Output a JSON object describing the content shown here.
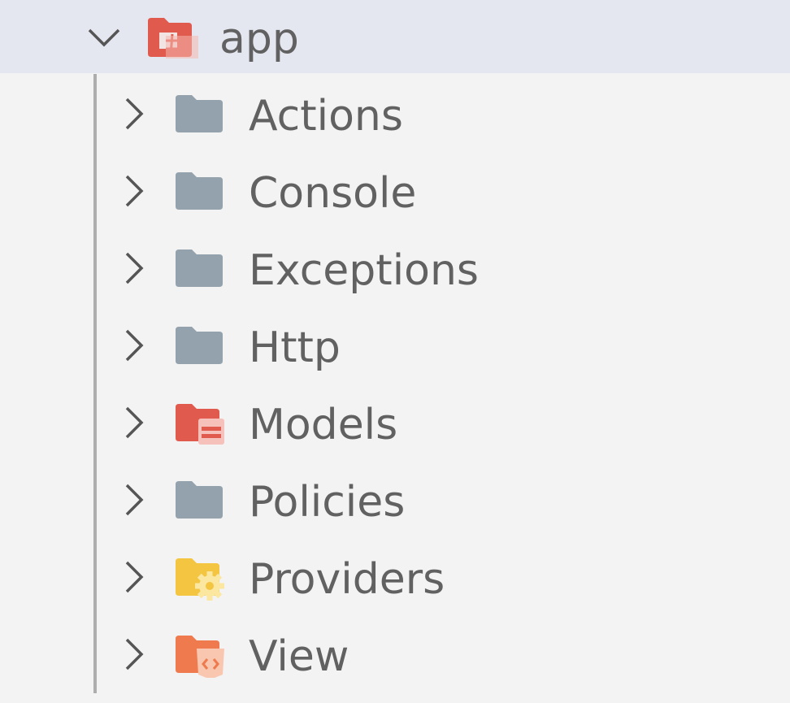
{
  "root": {
    "label": "app",
    "expanded": true,
    "icon": "folder-app-icon",
    "icon_color": "#e05a4e"
  },
  "children": [
    {
      "label": "Actions",
      "icon": "folder-icon",
      "color": "#93a2ad"
    },
    {
      "label": "Console",
      "icon": "folder-icon",
      "color": "#93a2ad"
    },
    {
      "label": "Exceptions",
      "icon": "folder-icon",
      "color": "#93a2ad"
    },
    {
      "label": "Http",
      "icon": "folder-icon",
      "color": "#93a2ad"
    },
    {
      "label": "Models",
      "icon": "folder-models-icon",
      "color": "#e05a4e"
    },
    {
      "label": "Policies",
      "icon": "folder-icon",
      "color": "#93a2ad"
    },
    {
      "label": "Providers",
      "icon": "folder-config-icon",
      "color": "#f3c540"
    },
    {
      "label": "View",
      "icon": "folder-view-icon",
      "color": "#ee7a4d"
    }
  ],
  "colors": {
    "background": "#f3f3f3",
    "selected_row": "#e4e6f0",
    "text": "#616161",
    "guide": "#adadad"
  }
}
